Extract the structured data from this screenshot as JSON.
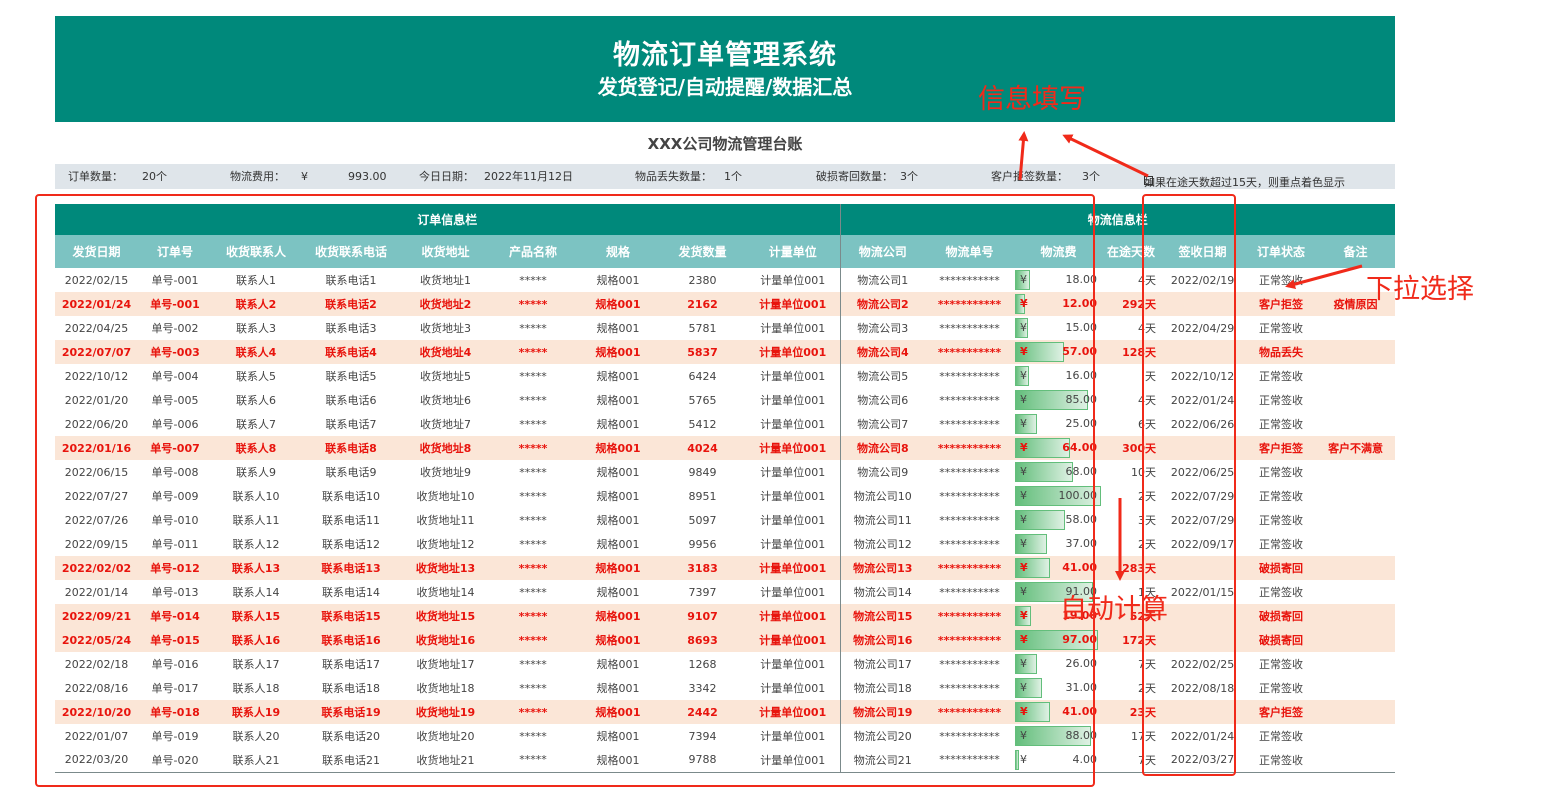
{
  "banner": {
    "title": "物流订单管理系统",
    "subtitle": "发货登记/自动提醒/数据汇总"
  },
  "ledger_title": "XXX公司物流管理台账",
  "stats": {
    "order_count_label": "订单数量：",
    "order_count": "20个",
    "fee_label": "物流费用：",
    "fee_currency": "¥",
    "fee_total": "993.00",
    "today_label": "今日日期：",
    "today": "2022年11月12日",
    "lost_label": "物品丢失数量：",
    "lost": "1个",
    "damaged_label": "破损寄回数量：",
    "damaged": "3个",
    "rejected_label": "客户拒签数量：",
    "rejected": "3个",
    "overdue_note": "如果在途天数超过15天，则重点着色显示",
    "checkbox_glyph": "☑"
  },
  "groups": {
    "order": "订单信息栏",
    "logistics": "物流信息栏"
  },
  "columns": [
    "发货日期",
    "订单号",
    "收货联系人",
    "收货联系电话",
    "收货地址",
    "产品名称",
    "规格",
    "发货数量",
    "计量单位",
    "物流公司",
    "物流单号",
    "物流费",
    "在途天数",
    "签收日期",
    "订单状态",
    "备注"
  ],
  "currency": "¥",
  "rows": [
    {
      "date": "2022/02/15",
      "order": "单号-001",
      "contact": "联系人1",
      "phone": "联系电话1",
      "addr": "收货地址1",
      "product": "*****",
      "spec": "规格001",
      "qty": "2380",
      "unit": "计量单位001",
      "company": "物流公司1",
      "tracking": "***********",
      "fee": "18.00",
      "fee_value": 18,
      "days": "4天",
      "sign": "2022/02/19",
      "status": "正常签收",
      "remark": "",
      "hl": false
    },
    {
      "date": "2022/01/24",
      "order": "单号-001",
      "contact": "联系人2",
      "phone": "联系电话2",
      "addr": "收货地址2",
      "product": "*****",
      "spec": "规格001",
      "qty": "2162",
      "unit": "计量单位001",
      "company": "物流公司2",
      "tracking": "***********",
      "fee": "12.00",
      "fee_value": 12,
      "days": "292天",
      "sign": "",
      "status": "客户拒签",
      "remark": "疫情原因",
      "hl": true
    },
    {
      "date": "2022/04/25",
      "order": "单号-002",
      "contact": "联系人3",
      "phone": "联系电话3",
      "addr": "收货地址3",
      "product": "*****",
      "spec": "规格001",
      "qty": "5781",
      "unit": "计量单位001",
      "company": "物流公司3",
      "tracking": "***********",
      "fee": "15.00",
      "fee_value": 15,
      "days": "4天",
      "sign": "2022/04/29",
      "status": "正常签收",
      "remark": "",
      "hl": false
    },
    {
      "date": "2022/07/07",
      "order": "单号-003",
      "contact": "联系人4",
      "phone": "联系电话4",
      "addr": "收货地址4",
      "product": "*****",
      "spec": "规格001",
      "qty": "5837",
      "unit": "计量单位001",
      "company": "物流公司4",
      "tracking": "***********",
      "fee": "57.00",
      "fee_value": 57,
      "days": "128天",
      "sign": "",
      "status": "物品丢失",
      "remark": "",
      "hl": true
    },
    {
      "date": "2022/10/12",
      "order": "单号-004",
      "contact": "联系人5",
      "phone": "联系电话5",
      "addr": "收货地址5",
      "product": "*****",
      "spec": "规格001",
      "qty": "6424",
      "unit": "计量单位001",
      "company": "物流公司5",
      "tracking": "***********",
      "fee": "16.00",
      "fee_value": 16,
      "days": "天",
      "sign": "2022/10/12",
      "status": "正常签收",
      "remark": "",
      "hl": false
    },
    {
      "date": "2022/01/20",
      "order": "单号-005",
      "contact": "联系人6",
      "phone": "联系电话6",
      "addr": "收货地址6",
      "product": "*****",
      "spec": "规格001",
      "qty": "5765",
      "unit": "计量单位001",
      "company": "物流公司6",
      "tracking": "***********",
      "fee": "85.00",
      "fee_value": 85,
      "days": "4天",
      "sign": "2022/01/24",
      "status": "正常签收",
      "remark": "",
      "hl": false
    },
    {
      "date": "2022/06/20",
      "order": "单号-006",
      "contact": "联系人7",
      "phone": "联系电话7",
      "addr": "收货地址7",
      "product": "*****",
      "spec": "规格001",
      "qty": "5412",
      "unit": "计量单位001",
      "company": "物流公司7",
      "tracking": "***********",
      "fee": "25.00",
      "fee_value": 25,
      "days": "6天",
      "sign": "2022/06/26",
      "status": "正常签收",
      "remark": "",
      "hl": false
    },
    {
      "date": "2022/01/16",
      "order": "单号-007",
      "contact": "联系人8",
      "phone": "联系电话8",
      "addr": "收货地址8",
      "product": "*****",
      "spec": "规格001",
      "qty": "4024",
      "unit": "计量单位001",
      "company": "物流公司8",
      "tracking": "***********",
      "fee": "64.00",
      "fee_value": 64,
      "days": "300天",
      "sign": "",
      "status": "客户拒签",
      "remark": "客户不满意",
      "hl": true
    },
    {
      "date": "2022/06/15",
      "order": "单号-008",
      "contact": "联系人9",
      "phone": "联系电话9",
      "addr": "收货地址9",
      "product": "*****",
      "spec": "规格001",
      "qty": "9849",
      "unit": "计量单位001",
      "company": "物流公司9",
      "tracking": "***********",
      "fee": "68.00",
      "fee_value": 68,
      "days": "10天",
      "sign": "2022/06/25",
      "status": "正常签收",
      "remark": "",
      "hl": false
    },
    {
      "date": "2022/07/27",
      "order": "单号-009",
      "contact": "联系人10",
      "phone": "联系电话10",
      "addr": "收货地址10",
      "product": "*****",
      "spec": "规格001",
      "qty": "8951",
      "unit": "计量单位001",
      "company": "物流公司10",
      "tracking": "***********",
      "fee": "100.00",
      "fee_value": 100,
      "days": "2天",
      "sign": "2022/07/29",
      "status": "正常签收",
      "remark": "",
      "hl": false
    },
    {
      "date": "2022/07/26",
      "order": "单号-010",
      "contact": "联系人11",
      "phone": "联系电话11",
      "addr": "收货地址11",
      "product": "*****",
      "spec": "规格001",
      "qty": "5097",
      "unit": "计量单位001",
      "company": "物流公司11",
      "tracking": "***********",
      "fee": "58.00",
      "fee_value": 58,
      "days": "3天",
      "sign": "2022/07/29",
      "status": "正常签收",
      "remark": "",
      "hl": false
    },
    {
      "date": "2022/09/15",
      "order": "单号-011",
      "contact": "联系人12",
      "phone": "联系电话12",
      "addr": "收货地址12",
      "product": "*****",
      "spec": "规格001",
      "qty": "9956",
      "unit": "计量单位001",
      "company": "物流公司12",
      "tracking": "***********",
      "fee": "37.00",
      "fee_value": 37,
      "days": "2天",
      "sign": "2022/09/17",
      "status": "正常签收",
      "remark": "",
      "hl": false
    },
    {
      "date": "2022/02/02",
      "order": "单号-012",
      "contact": "联系人13",
      "phone": "联系电话13",
      "addr": "收货地址13",
      "product": "*****",
      "spec": "规格001",
      "qty": "3183",
      "unit": "计量单位001",
      "company": "物流公司13",
      "tracking": "***********",
      "fee": "41.00",
      "fee_value": 41,
      "days": "283天",
      "sign": "",
      "status": "破损寄回",
      "remark": "",
      "hl": true
    },
    {
      "date": "2022/01/14",
      "order": "单号-013",
      "contact": "联系人14",
      "phone": "联系电话14",
      "addr": "收货地址14",
      "product": "*****",
      "spec": "规格001",
      "qty": "7397",
      "unit": "计量单位001",
      "company": "物流公司14",
      "tracking": "***********",
      "fee": "91.00",
      "fee_value": 91,
      "days": "1天",
      "sign": "2022/01/15",
      "status": "正常签收",
      "remark": "",
      "hl": false
    },
    {
      "date": "2022/09/21",
      "order": "单号-014",
      "contact": "联系人15",
      "phone": "联系电话15",
      "addr": "收货地址15",
      "product": "*****",
      "spec": "规格001",
      "qty": "9107",
      "unit": "计量单位001",
      "company": "物流公司15",
      "tracking": "***********",
      "fee": "19.00",
      "fee_value": 19,
      "days": "52天",
      "sign": "",
      "status": "破损寄回",
      "remark": "",
      "hl": true
    },
    {
      "date": "2022/05/24",
      "order": "单号-015",
      "contact": "联系人16",
      "phone": "联系电话16",
      "addr": "收货地址16",
      "product": "*****",
      "spec": "规格001",
      "qty": "8693",
      "unit": "计量单位001",
      "company": "物流公司16",
      "tracking": "***********",
      "fee": "97.00",
      "fee_value": 97,
      "days": "172天",
      "sign": "",
      "status": "破损寄回",
      "remark": "",
      "hl": true
    },
    {
      "date": "2022/02/18",
      "order": "单号-016",
      "contact": "联系人17",
      "phone": "联系电话17",
      "addr": "收货地址17",
      "product": "*****",
      "spec": "规格001",
      "qty": "1268",
      "unit": "计量单位001",
      "company": "物流公司17",
      "tracking": "***********",
      "fee": "26.00",
      "fee_value": 26,
      "days": "7天",
      "sign": "2022/02/25",
      "status": "正常签收",
      "remark": "",
      "hl": false
    },
    {
      "date": "2022/08/16",
      "order": "单号-017",
      "contact": "联系人18",
      "phone": "联系电话18",
      "addr": "收货地址18",
      "product": "*****",
      "spec": "规格001",
      "qty": "3342",
      "unit": "计量单位001",
      "company": "物流公司18",
      "tracking": "***********",
      "fee": "31.00",
      "fee_value": 31,
      "days": "2天",
      "sign": "2022/08/18",
      "status": "正常签收",
      "remark": "",
      "hl": false
    },
    {
      "date": "2022/10/20",
      "order": "单号-018",
      "contact": "联系人19",
      "phone": "联系电话19",
      "addr": "收货地址19",
      "product": "*****",
      "spec": "规格001",
      "qty": "2442",
      "unit": "计量单位001",
      "company": "物流公司19",
      "tracking": "***********",
      "fee": "41.00",
      "fee_value": 41,
      "days": "23天",
      "sign": "",
      "status": "客户拒签",
      "remark": "",
      "hl": true
    },
    {
      "date": "2022/01/07",
      "order": "单号-019",
      "contact": "联系人20",
      "phone": "联系电话20",
      "addr": "收货地址20",
      "product": "*****",
      "spec": "规格001",
      "qty": "7394",
      "unit": "计量单位001",
      "company": "物流公司20",
      "tracking": "***********",
      "fee": "88.00",
      "fee_value": 88,
      "days": "17天",
      "sign": "2022/01/24",
      "status": "正常签收",
      "remark": "",
      "hl": false
    },
    {
      "date": "2022/03/20",
      "order": "单号-020",
      "contact": "联系人21",
      "phone": "联系电话21",
      "addr": "收货地址21",
      "product": "*****",
      "spec": "规格001",
      "qty": "9788",
      "unit": "计量单位001",
      "company": "物流公司21",
      "tracking": "***********",
      "fee": "4.00",
      "fee_value": 4,
      "days": "7天",
      "sign": "2022/03/27",
      "status": "正常签收",
      "remark": "",
      "hl": false
    }
  ],
  "annotations": {
    "fill_in": "信息填写",
    "dropdown": "下拉选择",
    "auto_calc": "自动计算"
  },
  "colors": {
    "header_teal": "#00897b",
    "column_header": "#7cc3c2",
    "highlight_row": "#fbe6d7",
    "highlight_text": "#e8140d",
    "annotation_red": "#f02a1a",
    "bar_green": "#63be7b"
  }
}
